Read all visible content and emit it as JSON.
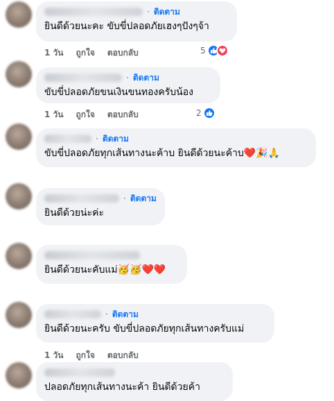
{
  "follow_label": "ติดตาม",
  "separator": "·",
  "action_labels": {
    "time": "1 วัน",
    "like": "ถูกใจ",
    "reply": "ตอบกลับ"
  },
  "comments": [
    {
      "text": "ยินดีด้วยนะคะ ขับขี่ปลอดภัยเฮงๆปังๆจ้า",
      "reaction_count": "5",
      "reactions": [
        "like-icon",
        "love-icon"
      ]
    },
    {
      "text": "ขับขี่ปลอดภัยขนเงินขนทองครับน้อง",
      "reaction_count": "2",
      "reactions": [
        "like-icon"
      ]
    },
    {
      "text": "ขับขี่ปลอดภัยทุกเส้นทางนะค้าบ ยินดีด้วยนะค้าบ",
      "emojis": "❤️🎉🙏"
    },
    {
      "text": "ยินดีด้วยน่ะค่ะ"
    },
    {
      "text": "ยินดีด้วยนะคับแม่",
      "emojis": "🥳🥳❤️❤️"
    },
    {
      "text": "ยินดีด้วยนะครับ ขับขี่ปลอดภัยทุกเส้นทางครับแม่"
    },
    {
      "text": "ปลอดภัยทุกเส้นทางนะค้า ยินดีด้วยค้า"
    }
  ],
  "colors": {
    "link": "#1877f2",
    "bubble": "#f0f2f5",
    "muted": "#65676b",
    "love": "#f33e58"
  }
}
